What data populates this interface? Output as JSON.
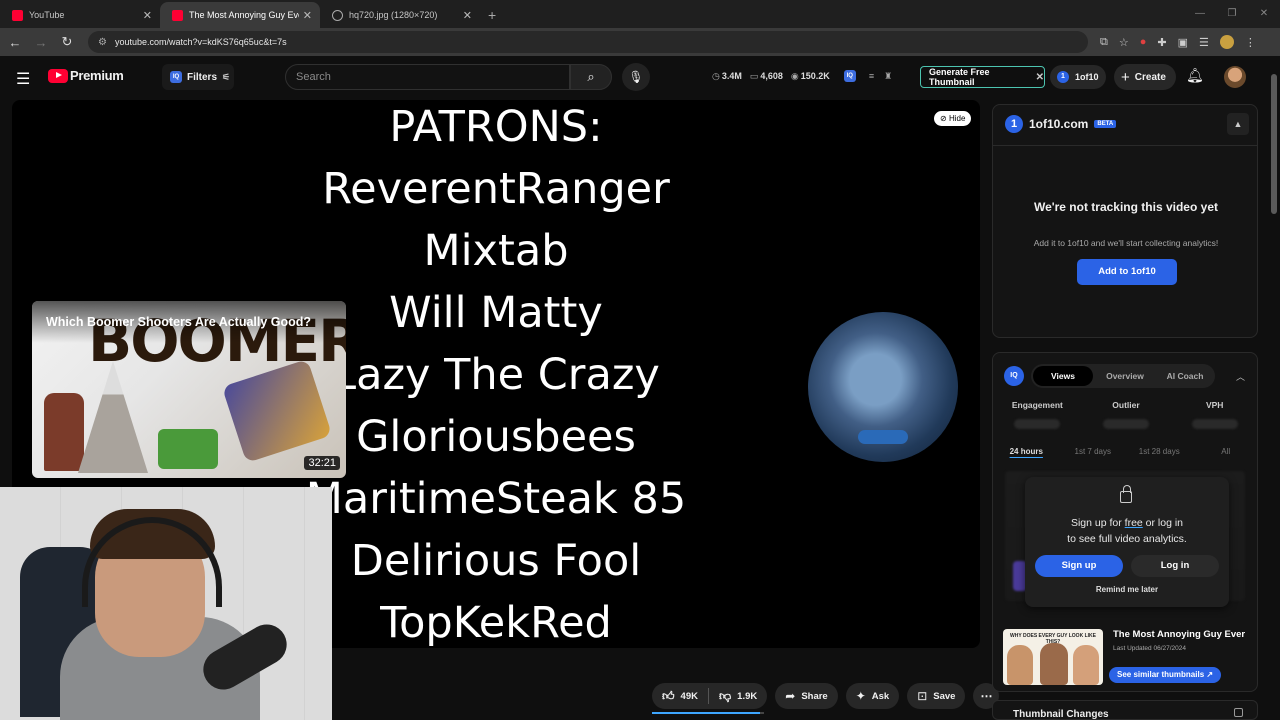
{
  "browser": {
    "tabs": [
      {
        "title": "YouTube",
        "icon": "youtube-icon",
        "active": false
      },
      {
        "title": "The Most Annoying Guy Ever -",
        "icon": "youtube-icon",
        "active": true
      },
      {
        "title": "hq720.jpg (1280×720)",
        "icon": "globe-icon",
        "active": false
      }
    ],
    "url": "youtube.com/watch?v=kdKS76q65uc&t=7s"
  },
  "header": {
    "logo_text": "Premium",
    "filters_label": "Filters",
    "search_placeholder": "Search",
    "stats": {
      "views": "3.4M",
      "comments": "4,608",
      "watching": "150.2K"
    },
    "generate_label": "Generate Free Thumbnail",
    "oneof10_label": "1of10",
    "create_label": "Create"
  },
  "video": {
    "credits": [
      "PATRONS:",
      "ReverentRanger",
      "Mixtab",
      "Will Matty",
      "Lazy The Crazy",
      "Gloriousbees",
      "MaritimeSteak 85",
      "Delirious Fool",
      "TopKekRed"
    ],
    "hide_label": "Hide",
    "endcard": {
      "title": "Which Boomer Shooters Are Actually Good?",
      "art_text": "BOOMER",
      "duration": "32:21"
    }
  },
  "actions": {
    "likes": "49K",
    "dislikes": "1.9K",
    "share": "Share",
    "ask": "Ask",
    "save": "Save",
    "like_ratio": 0.96
  },
  "oneof10_panel": {
    "logo_char": "1",
    "brand": "1of10.com",
    "beta": "BETA",
    "heading": "We're not tracking this video yet",
    "subtext": "Add it to 1of10 and we'll start collecting analytics!",
    "button": "Add to 1of10"
  },
  "iq_panel": {
    "badge": "IQ",
    "tabs": [
      "Views",
      "Overview",
      "AI Coach"
    ],
    "metrics": [
      "Engagement",
      "Outlier",
      "VPH"
    ],
    "time_tabs": [
      "24 hours",
      "1st 7 days",
      "1st 28 days",
      "All"
    ],
    "overlay": {
      "line1_pre": "Sign up for ",
      "line1_link": "free",
      "line1_post": " or log in",
      "line2": "to see full video analytics.",
      "signup": "Sign up",
      "login": "Log in",
      "remind": "Remind me later"
    },
    "video_card": {
      "thumb_caption": "WHY DOES EVERY GUY LOOK LIKE THIS?",
      "title": "The Most Annoying Guy Ever",
      "updated": "Last Updated 06/27/2024",
      "similar": "See similar thumbnails ↗"
    },
    "thumbnail_changes": "Thumbnail Changes"
  },
  "colors": {
    "accent": "#2b63e6",
    "youtube_red": "#ff0033",
    "generate_border": "#4cc4b0"
  }
}
